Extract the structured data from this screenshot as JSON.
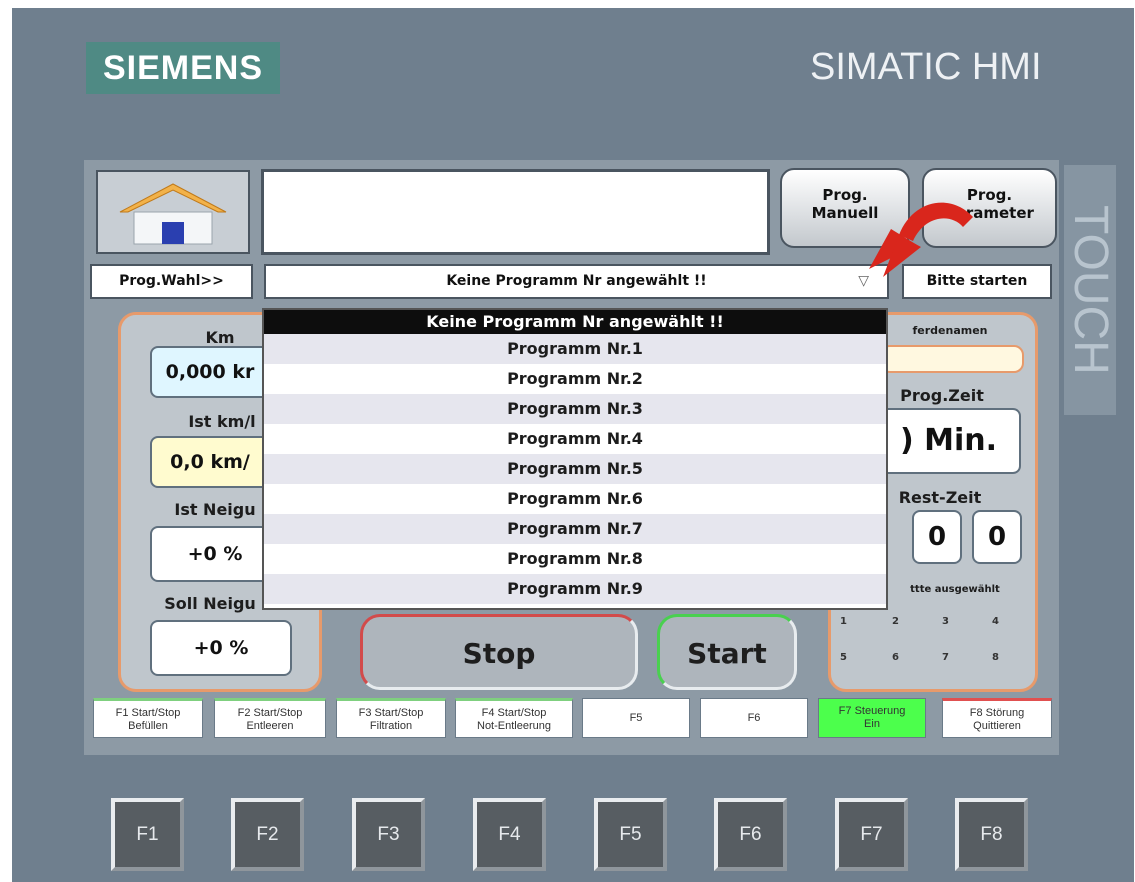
{
  "device": {
    "brand_logo": "SIEMENS",
    "product_name": "SIMATIC HMI",
    "side_label": "TOUCH"
  },
  "toolbar": {
    "home_icon": "house-icon",
    "prog_manuell_label": "Prog.\nManuell",
    "prog_parameter_label": "Prog.\nParameter",
    "prog_parameter_visible": "Prog.\n  ameter"
  },
  "program_select": {
    "label": "Prog.Wahl>>",
    "selected_value": "Keine Programm Nr angewählt !!",
    "start_hint": "Bitte starten",
    "options": [
      "Keine Programm Nr angewählt !!",
      "Programm Nr.1",
      "Programm Nr.2",
      "Programm Nr.3",
      "Programm Nr.4",
      "Programm Nr.5",
      "Programm Nr.6",
      "Programm Nr.7",
      "Programm Nr.8",
      "Programm Nr.9"
    ]
  },
  "left_panel": {
    "km_label": "Km",
    "km_value": "0,000 kr",
    "ist_speed_label": "Ist km/l",
    "ist_speed_value": "0,0 km/",
    "ist_neigung_label": "Ist Neigu",
    "ist_neigung_value": "+0 %",
    "soll_neigung_label": "Soll Neigu",
    "soll_neigung_value": "+0 %"
  },
  "right_panel": {
    "pferdenamen_label": "ferdenamen",
    "prog_zeit_label": "Prog.Zeit",
    "prog_zeit_value": ") Min.",
    "rest_zeit_label": "Rest-Zeit",
    "rest_zeit_min": "0",
    "rest_zeit_sec": "0",
    "auswahl_label": "ttte ausgewählt",
    "numbers_row1": [
      "1",
      "2",
      "3",
      "4"
    ],
    "numbers_row2": [
      "5",
      "6",
      "7",
      "8"
    ]
  },
  "controls": {
    "stop_label": "Stop",
    "start_label": "Start"
  },
  "function_labels": [
    "F1 Start/Stop\nBefüllen",
    "F2 Start/Stop\nEntleeren",
    "F3 Start/Stop\nFiltration",
    "F4 Start/Stop\nNot-Entleerung",
    "F5",
    "F6",
    "F7 Steuerung\nEin",
    "F8 Störung\nQuittieren"
  ],
  "hardware_keys": [
    "F1",
    "F2",
    "F3",
    "F4",
    "F5",
    "F6",
    "F7",
    "F8"
  ],
  "colors": {
    "bezel": "#6f7f8e",
    "logo_bg": "#4f8a84",
    "panel_border": "#e79a6b",
    "green_active": "#4cff4c",
    "arrow_red": "#d9261c"
  }
}
